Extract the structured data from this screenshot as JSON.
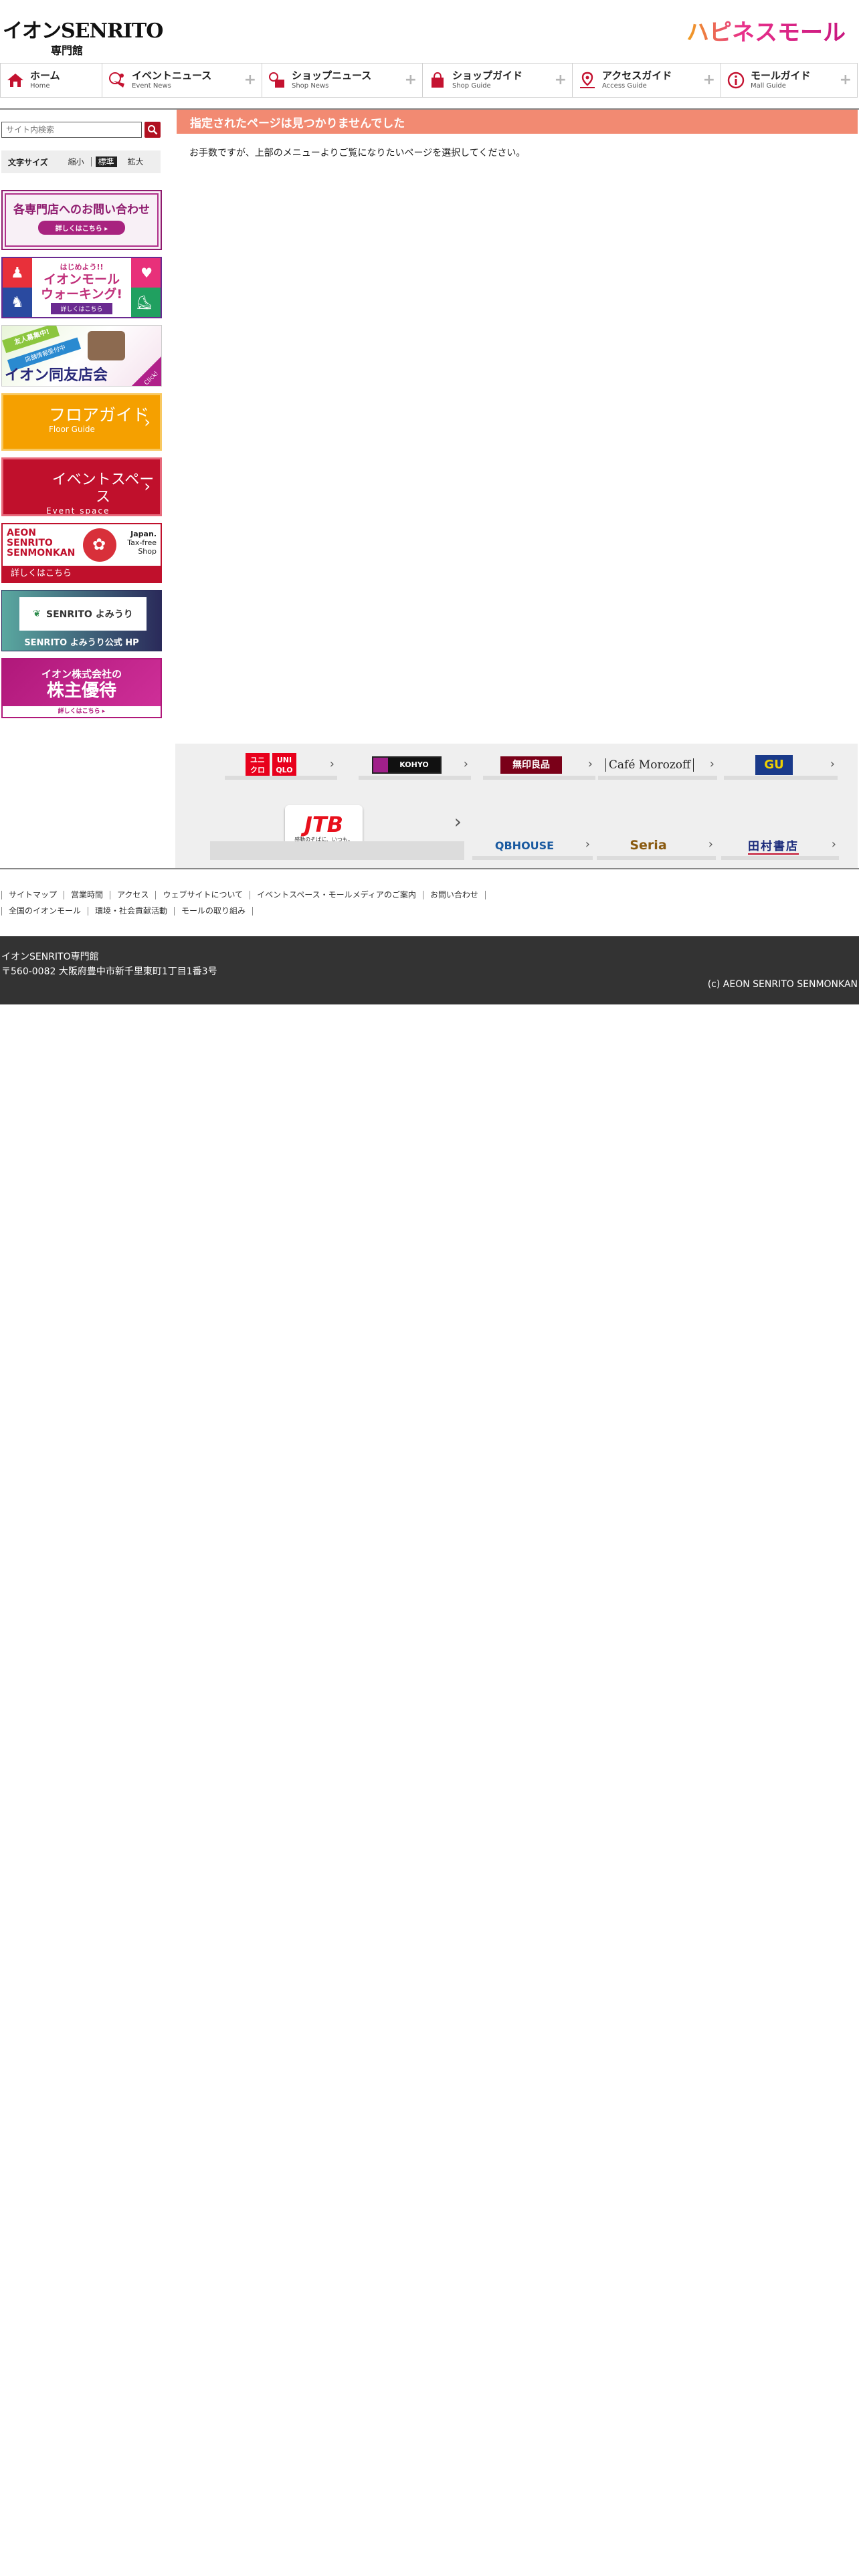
{
  "header": {
    "logo_main": "イオンSENRITO",
    "logo_sub": "専門館",
    "mall_logo": "ハピネスモール"
  },
  "nav": [
    {
      "jp": "ホーム",
      "en": "Home",
      "icon": "home-icon"
    },
    {
      "jp": "イベントニュース",
      "en": "Event News",
      "icon": "event-icon"
    },
    {
      "jp": "ショップニュース",
      "en": "Shop News",
      "icon": "shop-news-icon"
    },
    {
      "jp": "ショップガイド",
      "en": "Shop Guide",
      "icon": "bag-icon"
    },
    {
      "jp": "アクセスガイド",
      "en": "Access Guide",
      "icon": "map-pin-icon"
    },
    {
      "jp": "モールガイド",
      "en": "Mall Guide",
      "icon": "info-icon"
    }
  ],
  "sidebar": {
    "search_placeholder": "サイト内検索",
    "fontsize": {
      "label": "文字サイズ",
      "small": "縮小",
      "normal": "標準",
      "large": "拡大"
    },
    "banners": {
      "inquiry": {
        "title": "各専門店へのお問い合わせ",
        "button": "詳しくはこちら ▸"
      },
      "walking": {
        "small": "はじめよう!!",
        "title1": "イオンモール",
        "title2": "ウォーキング!",
        "button": "詳しくはこちら"
      },
      "doyukai": {
        "tag1": "友人募集中!",
        "tag2": "店舗情報受付中",
        "title": "イオン同友店会",
        "more": "Click!"
      },
      "floor": {
        "title": "フロアガイド",
        "sub": "Floor Guide"
      },
      "event": {
        "title": "イベントスペース",
        "sub": "Event space"
      },
      "taxfree": {
        "line1": "AEON",
        "line2": "SENRITO",
        "line3": "SENMONKAN",
        "right1": "Japan.",
        "right2": "Tax-free",
        "right3": "Shop",
        "button": "詳しくはこちら"
      },
      "yomiuri": {
        "logo": "SENRITO よみうり",
        "caption": "SENRITO よみうり公式 HP"
      },
      "shareholder": {
        "line1": "イオン株式会社の",
        "line2": "株主優待",
        "button": "詳しくはこちら ▸"
      }
    }
  },
  "main": {
    "heading": "指定されたページは見つかりませんでした",
    "message": "お手数ですが、上部のメニューよりご覧になりたいページを選択してください。"
  },
  "shops": {
    "uniqlo_a": "ユニ",
    "uniqlo_b": "クロ",
    "uniqlo_c": "UNI",
    "uniqlo_d": "QLO",
    "koiyo": "KOHYO",
    "muji": "無印良品",
    "morozoff": "Café Morozoff",
    "gu": "GU",
    "jtb": "JTB",
    "jtb_sub": "感動のそばに、いつも。",
    "qbhouse": "QBHOUSE",
    "seria": "Seria",
    "tamura": "田村書店"
  },
  "footer": {
    "links1": [
      "サイトマップ",
      "営業時間",
      "アクセス",
      "ウェブサイトについて",
      "イベントスペース・モールメディアのご案内",
      "お問い合わせ"
    ],
    "links2": [
      "全国のイオンモール",
      "環境・社会貢献活動",
      "モールの取り組み"
    ],
    "name": "イオンSENRITO専門館",
    "address": "〒560-0082 大阪府豊中市新千里東町1丁目1番3号",
    "copyright": "(c) AEON SENRITO SENMONKAN"
  }
}
